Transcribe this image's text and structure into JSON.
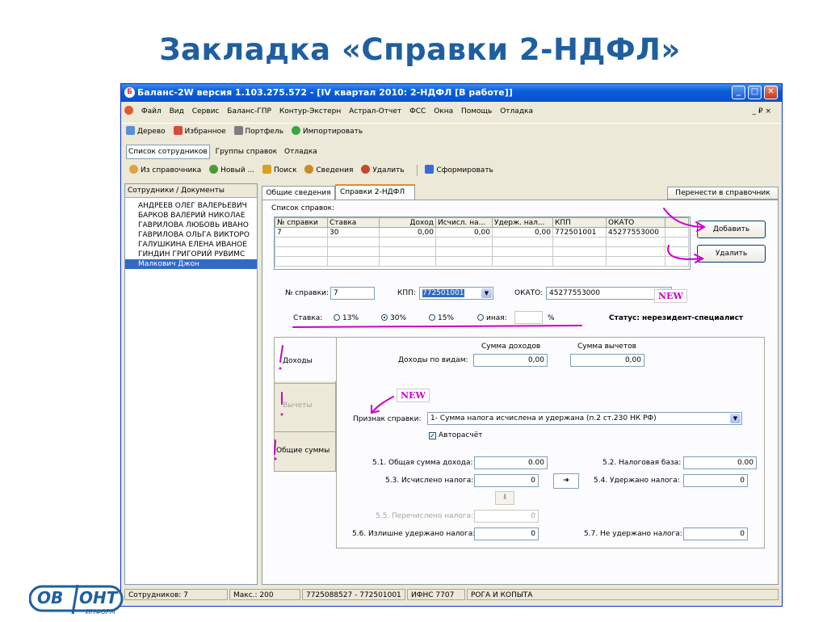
{
  "slide_title": "Закладка «Справки 2-НДФЛ»",
  "window": {
    "title": "Баланс-2W  версия 1.103.275.572 - [IV квартал 2010: 2-НДФЛ [В работе]]",
    "controls": {
      "minimize": "_",
      "maximize": "□",
      "close": "✕"
    }
  },
  "menu": {
    "items": [
      "Файл",
      "Вид",
      "Сервис",
      "Баланс-ГПР",
      "Контур-Экстерн",
      "Астрал-Отчет",
      "ФСС",
      "Окна",
      "Помощь",
      "Отладка"
    ],
    "mdi_controls": "_ ₽ ×"
  },
  "toolbar1": {
    "items": [
      "Дерево",
      "Избранное",
      "Портфель",
      "Импортировать"
    ]
  },
  "view_tabs": {
    "items": [
      "Список сотрудников",
      "Группы справок",
      "Отладка"
    ]
  },
  "toolbar2": {
    "items": [
      "Из справочника",
      "Новый ...",
      "Поиск",
      "Сведения",
      "Удалить",
      "Сформировать"
    ]
  },
  "left_panel": {
    "header": "Сотрудники / Документы",
    "employees": [
      "АНДРЕЕВ ОЛЕГ ВАЛЕРЬЕВИЧ",
      "БАРКОВ ВАЛЕРИЙ НИКОЛАЕ",
      "ГАВРИЛОВА ЛЮБОВЬ ИВАНО",
      "ГАВРИЛОВА ОЛЬГА ВИКТОРО",
      "ГАЛУШКИНА ЕЛЕНА ИВАНОЕ",
      "ГИНДИН ГРИГОРИЙ РУВИМС",
      "Малкович Джон"
    ],
    "selected_index": 6
  },
  "tabs": {
    "general": "Общие сведения",
    "certs": "Справки 2-НДФЛ",
    "transfer_button": "Перенести в справочник"
  },
  "cert_list": {
    "label": "Список справок:",
    "columns": [
      "№ справки",
      "Ставка",
      "Доход",
      "Исчисл. на...",
      "Удерж. нал...",
      "КПП",
      "ОКАТО"
    ],
    "rows": [
      [
        "7",
        "30",
        "0,00",
        "0,00",
        "0,00",
        "772501001",
        "45277553000"
      ]
    ],
    "add_button": "Добавить",
    "delete_button": "Удалить"
  },
  "form": {
    "cert_no_label": "№ справки:",
    "cert_no": "7",
    "kpp_label": "КПП:",
    "kpp": "772501001",
    "okato_label": "ОКАТО:",
    "okato": "45277553000",
    "rate_label": "Ставка:",
    "rates": [
      "13%",
      "30%",
      "15%",
      "иная:"
    ],
    "rate_selected": 1,
    "percent": "%",
    "status_text": "Статус: нерезидент-специалист"
  },
  "side_tabs": {
    "income": "Доходы",
    "deductions": "Вычеты",
    "totals": "Общие суммы"
  },
  "income": {
    "col_income": "Сумма доходов",
    "col_deductions": "Сумма вычетов",
    "by_type_label": "Доходы по видам:",
    "income_value": "0,00",
    "deductions_value": "0,00"
  },
  "sign": {
    "label": "Признак справки:",
    "value": "1- Сумма налога исчислена и удержана (п.2 ст.230 НК РФ)",
    "auto_calc": "Авторасчёт"
  },
  "totals": {
    "l51": "5.1. Общая сумма дохода:",
    "v51": "0.00",
    "l52": "5.2. Налоговая база:",
    "v52": "0.00",
    "l53": "5.3. Исчислено налога:",
    "v53": "0",
    "l54": "5.4. Удержано налога:",
    "v54": "0",
    "l55": "5.5. Перечислено налога:",
    "v55": "0",
    "l56": "5.6. Излишне удержано налога:",
    "v56": "0",
    "l57": "5.7. Не удержано налога:",
    "v57": "0"
  },
  "annotations": {
    "new": "NEW",
    "excl": "!"
  },
  "status_bar": {
    "employees": "Сотрудников: 7",
    "max": "Макс.: 200",
    "inn_kpp": "7725088527 - 772501001",
    "ifns": "ИФНС 7707",
    "org": "РОГА И КОПЫТА"
  },
  "logo": {
    "left": "ОВ",
    "right": "ОНТ",
    "sub": "ИНФОРМ"
  },
  "colors": {
    "title": "#1f5fa0",
    "annotation": "#cc00cc",
    "selection": "#316ac5",
    "titlebar": "#0a5fd8"
  }
}
